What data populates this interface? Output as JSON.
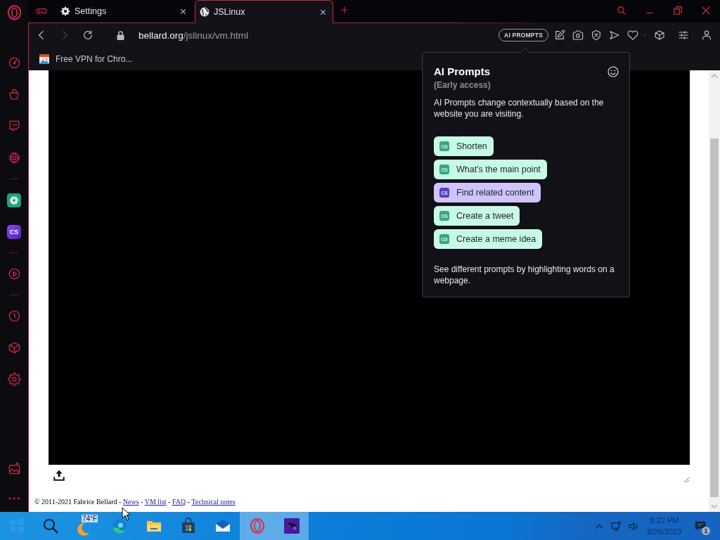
{
  "sidebar": {
    "cs_logo": "CS"
  },
  "tabs": [
    {
      "title": "Settings",
      "selected": false
    },
    {
      "title": "JSLinux",
      "selected": true
    }
  ],
  "toolbar": {
    "url_host": "bellard.org",
    "url_path": "/jslinux/vm.html",
    "ai_prompts_button": "AI PROMPTS"
  },
  "bookmarks": [
    {
      "label": "Free VPN for Chro..."
    }
  ],
  "page": {
    "footer": [
      {
        "kind": "text",
        "text": "© 2011-2021 Fabrice Bellard - "
      },
      {
        "kind": "link",
        "text": "News"
      },
      {
        "kind": "text",
        "text": " - "
      },
      {
        "kind": "link",
        "text": "VM list"
      },
      {
        "kind": "text",
        "text": " - "
      },
      {
        "kind": "link",
        "text": "FAQ"
      },
      {
        "kind": "text",
        "text": " - "
      },
      {
        "kind": "link",
        "text": "Technical notes"
      }
    ]
  },
  "ai_prompts_popup": {
    "title": "AI Prompts",
    "subtitle": "(Early access)",
    "description": "AI Prompts change contextually based on the website you are visiting.",
    "prompts": [
      {
        "badge": "CG",
        "label": "Shorten",
        "color": "#3aa57e"
      },
      {
        "badge": "CG",
        "label": "What's the main point",
        "color": "#3aa57e"
      },
      {
        "badge": "CS",
        "label": "Find related content",
        "color": "#5b3fc9"
      },
      {
        "badge": "CG",
        "label": "Create a tweet",
        "color": "#3aa57e"
      },
      {
        "badge": "CG",
        "label": "Create a meme idea",
        "color": "#3aa57e"
      }
    ],
    "hint": "See different prompts by highlighting words on a webpage."
  },
  "taskbar": {
    "weather": "74°F",
    "apps": [
      {
        "selected": false
      },
      {
        "selected": false
      },
      {
        "selected": false
      },
      {
        "selected": false
      },
      {
        "selected": true
      },
      {
        "selected": true
      }
    ],
    "time": "8:22 PM",
    "date": "8/26/2023",
    "notification_count": "1"
  }
}
